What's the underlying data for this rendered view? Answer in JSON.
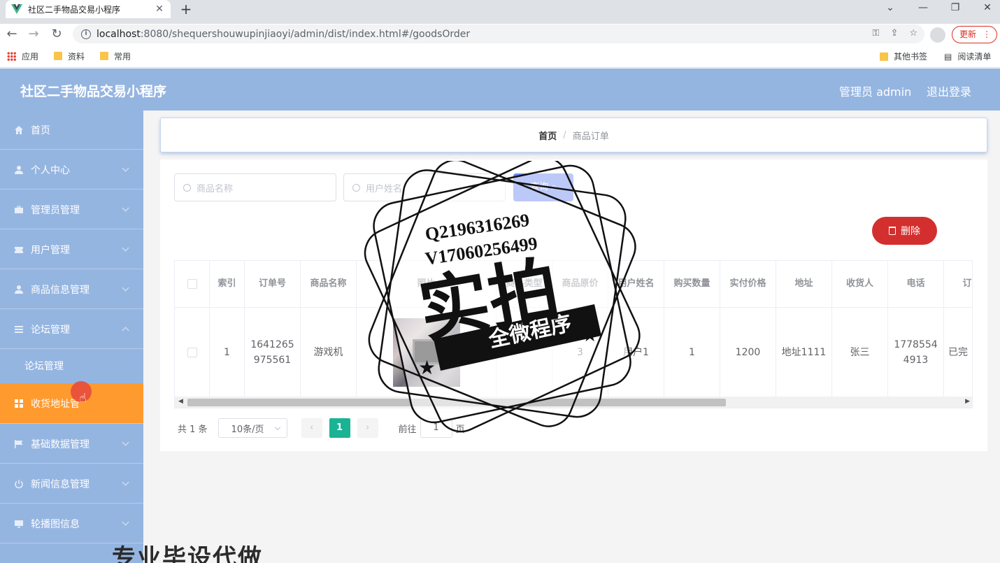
{
  "browser": {
    "tab_title": "社区二手物品交易小程序",
    "url_host": "localhost",
    "url_rest": ":8080/shequershouwupinjiaoyi/admin/dist/index.html#/goodsOrder",
    "update_label": "更新",
    "bookmarks": [
      "应用",
      "资料",
      "常用"
    ],
    "bookmarks_right": [
      "其他书签",
      "阅读清单"
    ]
  },
  "header": {
    "title": "社区二手物品交易小程序",
    "admin_label": "管理员 admin",
    "logout_label": "退出登录"
  },
  "sidebar": {
    "items": [
      {
        "label": "首页",
        "icon": "home-icon"
      },
      {
        "label": "个人中心",
        "icon": "user-icon"
      },
      {
        "label": "管理员管理",
        "icon": "briefcase-icon"
      },
      {
        "label": "用户管理",
        "icon": "ticket-icon"
      },
      {
        "label": "商品信息管理",
        "icon": "user-icon"
      },
      {
        "label": "论坛管理",
        "icon": "list-icon"
      },
      {
        "label": "收货地址管理",
        "icon": "grid-icon"
      },
      {
        "label": "基础数据管理",
        "icon": "flag-icon"
      },
      {
        "label": "新闻信息管理",
        "icon": "power-icon"
      },
      {
        "label": "轮播图信息",
        "icon": "monitor-icon"
      }
    ],
    "submenu_label": "论坛管理",
    "active_label_visible": "收货地址管"
  },
  "breadcrumb": {
    "home": "首页",
    "separator": "/",
    "current": "商品订单"
  },
  "search": {
    "goods_name_placeholder": "商品名称",
    "user_name_placeholder": "用户姓名",
    "query_label": "查询"
  },
  "actions": {
    "delete_label": "删除"
  },
  "table": {
    "headers": [
      "索引",
      "订单号",
      "商品名称",
      "照片",
      "商品类型",
      "商品原价",
      "用户姓名",
      "购买数量",
      "实付价格",
      "地址",
      "收货人",
      "电话",
      "订单"
    ],
    "row": {
      "index": "1",
      "order_no": "1641265975561",
      "goods_name": "游戏机",
      "goods_type": "",
      "original_price": "3",
      "user_name": "用户1",
      "quantity": "1",
      "paid_price": "1200",
      "address": "地址1111",
      "receiver": "张三",
      "phone": "17785544913",
      "status": "已完"
    }
  },
  "pagination": {
    "total": "共 1 条",
    "page_size": "10条/页",
    "current_page": "1",
    "goto_label": "前往",
    "goto_value": "1",
    "page_suffix": "页"
  },
  "watermark": {
    "qq": "Q2196316269",
    "vx": "V17060256499",
    "big_text": "实拍",
    "ribbon": "全微程序"
  },
  "bottom_banner": "专业毕设代做"
}
